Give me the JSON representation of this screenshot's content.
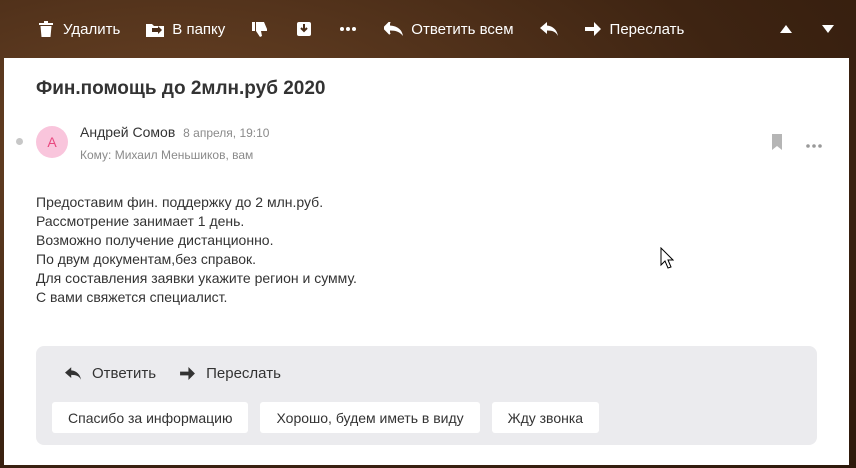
{
  "toolbar": {
    "delete_label": "Удалить",
    "move_label": "В папку",
    "reply_all_label": "Ответить всем",
    "forward_label": "Переслать"
  },
  "message": {
    "subject": "Фин.помощь до 2млн.руб 2020",
    "avatar_letter": "А",
    "sender_name": "Андрей Сомов",
    "date": "8 апреля, 19:10",
    "recipients": "Кому: Михаил Меньшиков, вам",
    "body_lines": [
      "Предоставим фин. поддержку до 2 млн.руб.",
      "Рассмотрение занимает 1 день.",
      "Возможно получение дистанционно.",
      "По двум документам,без справок.",
      "Для составления заявки укажите регион и сумму.",
      "С вами свяжется специалист."
    ]
  },
  "reply_box": {
    "reply_label": "Ответить",
    "forward_label": "Переслать",
    "quick_replies": [
      "Спасибо за информацию",
      "Хорошо, будем иметь в виду",
      "Жду звонка"
    ]
  },
  "colors": {
    "avatar_bg": "#f9c5dc",
    "avatar_fg": "#e8487f",
    "reply_box_bg": "#ebebee"
  }
}
